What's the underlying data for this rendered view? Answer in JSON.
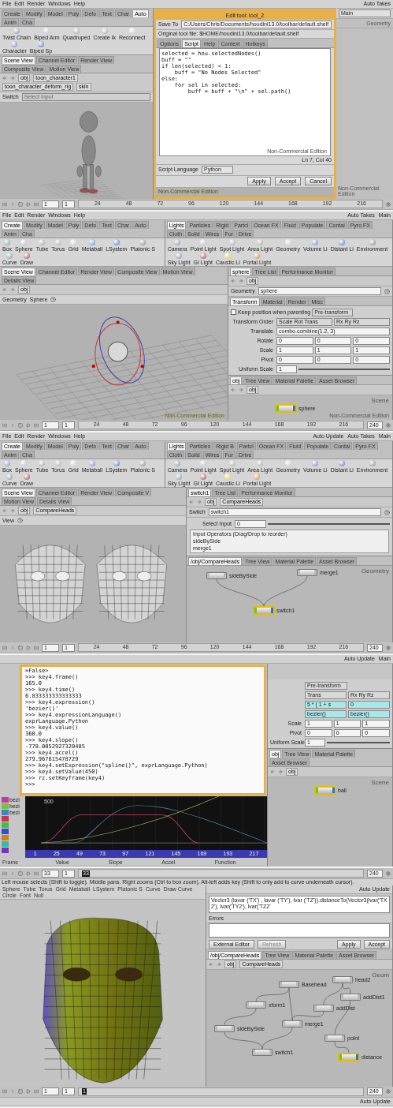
{
  "edit_tool_window": {
    "menu": [
      "File",
      "Edit",
      "Render",
      "Windows",
      "Help"
    ],
    "top_right": [
      "Auto Takes"
    ],
    "shelf": {
      "tabs": [
        {
          "label": "Create",
          "selected": false
        },
        {
          "label": "Modify",
          "selected": false
        },
        {
          "label": "Model",
          "selected": false
        },
        {
          "label": "Poly",
          "selected": false
        },
        {
          "label": "Defo",
          "selected": false
        },
        {
          "label": "Text",
          "selected": false
        },
        {
          "label": "Char",
          "selected": false
        },
        {
          "label": "Auto",
          "selected": true
        },
        {
          "label": "Anim",
          "selected": false
        },
        {
          "label": "Cha",
          "selected": false
        }
      ],
      "tools": [
        "Twist Chain",
        "Biped Arm",
        "Quadruped",
        "Create Ik",
        "Reconnect",
        "Character",
        "Biped Sp"
      ]
    },
    "pane_tabs": [
      {
        "label": "Scene View",
        "selected": true
      },
      {
        "label": "Channel Editor",
        "selected": false
      },
      {
        "label": "Render View",
        "selected": false
      },
      {
        "label": "Composite View",
        "selected": false
      },
      {
        "label": "Motion View",
        "selected": false
      }
    ],
    "path": [
      "obj",
      "toon_character1",
      "toon_character_deform_rig",
      "skin"
    ],
    "operator": {
      "label": "Switch",
      "placeholder": "Select Input"
    },
    "viewport": {
      "kind": "character"
    },
    "dialog": {
      "title": "Edit tool: tool_2",
      "save_to_label": "Save To",
      "save_to": "C:/Users/Chris/Documents/houdini13.0/toolbar/default.shelf",
      "original": "Original tool file: $HOME/houdini13.0/toolbar/default.shelf",
      "tabs": [
        {
          "label": "Options",
          "selected": false
        },
        {
          "label": "Script",
          "selected": true
        },
        {
          "label": "Help",
          "selected": false
        },
        {
          "label": "Context",
          "selected": false
        },
        {
          "label": "Hotkeys",
          "selected": false
        }
      ],
      "code": [
        "selected = hou.selectedNodes()",
        "buff = \"\"",
        "if len(selected) < 1:",
        "    buff = \"No Nodes Selected\"",
        "else:",
        "    for sel in selected:",
        "        buff = buff + \"\\n\" + sel.path()"
      ],
      "note": "Non-Commercial Edition",
      "cursor": "Ln 7, Col 40",
      "language_label": "Script Language",
      "language": "Python",
      "buttons": [
        "Apply",
        "Accept",
        "Cancel"
      ],
      "below_note": "Non-Commercial Edition"
    },
    "side": {
      "title": "Main",
      "context": "Geometry",
      "note": "Non-Commercial Edition"
    },
    "timeline": {
      "frame": "1",
      "step": "1",
      "ticks": [
        "24",
        "48",
        "72",
        "96",
        "120",
        "144",
        "168",
        "192",
        "216"
      ]
    }
  },
  "sphere_window": {
    "menu": [
      "File",
      "Edit",
      "Render",
      "Windows",
      "Help"
    ],
    "top_right": [
      "Auto Takes",
      "Main"
    ],
    "shelves": [
      {
        "tabs": [
          {
            "label": "Create",
            "selected": true
          },
          {
            "label": "Modify",
            "selected": false
          },
          {
            "label": "Model",
            "selected": false
          },
          {
            "label": "Poly",
            "selected": false
          },
          {
            "label": "Defo",
            "selected": false
          },
          {
            "label": "Text",
            "selected": false
          },
          {
            "label": "Char",
            "selected": false
          },
          {
            "label": "Auto",
            "selected": false
          },
          {
            "label": "Anim",
            "selected": false
          },
          {
            "label": "Cha",
            "selected": false
          }
        ],
        "tools": [
          "Box",
          "Sphere",
          "Tube",
          "Torus",
          "Grid",
          "Metaball",
          "LSystem",
          "Platonic S",
          "Curve",
          "Draw"
        ]
      },
      {
        "tabs": [
          {
            "label": "Lights",
            "selected": true
          },
          {
            "label": "Particles",
            "selected": false
          },
          {
            "label": "Rigid",
            "selected": false
          },
          {
            "label": "Partcl",
            "selected": false
          },
          {
            "label": "Ocean FX",
            "selected": false
          },
          {
            "label": "Fluid",
            "selected": false
          },
          {
            "label": "Populate",
            "selected": false
          },
          {
            "label": "Contai",
            "selected": false
          },
          {
            "label": "Pyro FX",
            "selected": false
          },
          {
            "label": "Cloth",
            "selected": false
          },
          {
            "label": "Solid",
            "selected": false
          },
          {
            "label": "Wires",
            "selected": false
          },
          {
            "label": "Fur",
            "selected": false
          },
          {
            "label": "Drive",
            "selected": false
          }
        ],
        "tools": [
          "Camera",
          "Point Light",
          "Spot Light",
          "Area Light",
          "Geometry",
          "Volume Li",
          "Distant Li",
          "Environment",
          "Sky Light",
          "GI Light",
          "Caustic Li",
          "Portal Light"
        ]
      }
    ],
    "pane_tabs": [
      {
        "label": "Scene View",
        "selected": true
      },
      {
        "label": "Channel Editor",
        "selected": false
      },
      {
        "label": "Render View",
        "selected": false
      },
      {
        "label": "Composite View",
        "selected": false
      },
      {
        "label": "Motion View",
        "selected": false
      },
      {
        "label": "Details View",
        "selected": false
      }
    ],
    "path": [
      "obj"
    ],
    "view_tools": [
      "Geometry",
      "Sphere"
    ],
    "viewport": {
      "kind": "sphere",
      "note": "Non-Commercial Edition"
    },
    "params": {
      "kind": "transform",
      "pane_tabs": [
        {
          "label": "sphere",
          "selected": true
        },
        {
          "label": "Tree List",
          "selected": false
        },
        {
          "label": "Performance Monitor",
          "selected": false
        }
      ],
      "path": [
        "obj"
      ],
      "type": "Geometry",
      "name": "sphere",
      "tabs": [
        {
          "label": "Transform",
          "selected": true
        },
        {
          "label": "Material",
          "selected": false
        },
        {
          "label": "Render",
          "selected": false
        },
        {
          "label": "Misc",
          "selected": false
        }
      ],
      "keep": {
        "label": "Keep position when parenting",
        "checked": false
      },
      "pre": "Pre-transform",
      "rows": [
        {
          "kind": "menu",
          "label": "Transform Order",
          "values": [
            "Scale Rot Trans",
            "Rx Ry Rz"
          ]
        },
        {
          "kind": "expression",
          "label": "Translate",
          "values": [
            "combo.combine(1.2, 3)"
          ]
        },
        {
          "kind": "vector",
          "label": "Rotate",
          "values": [
            "0",
            "0",
            "0"
          ]
        },
        {
          "kind": "vector",
          "label": "Scale",
          "values": [
            "1",
            "1",
            "1"
          ]
        },
        {
          "kind": "vector",
          "label": "Pivot",
          "values": [
            "0",
            "0",
            "0"
          ]
        },
        {
          "kind": "slider",
          "label": "Uniform Scale",
          "values": [
            "1"
          ]
        }
      ]
    },
    "network": {
      "tabs": [
        {
          "label": "obj",
          "selected": true
        },
        {
          "label": "Tree View",
          "selected": false
        },
        {
          "label": "Material Palette",
          "selected": false
        },
        {
          "label": "Asset Browser",
          "selected": false
        }
      ],
      "path": [
        "obj"
      ],
      "context": "Scene",
      "nodes": [
        {
          "label": "sphere",
          "selected": true
        }
      ],
      "note": "Non-Commercial Edition"
    },
    "timeline": {
      "frame": "1",
      "step": "1",
      "ticks": [
        "24",
        "48",
        "72",
        "96",
        "120",
        "144",
        "168",
        "192",
        "216"
      ],
      "end": "240"
    }
  },
  "compare_heads_window": {
    "menu": [
      "File",
      "Edit",
      "Render",
      "Windows",
      "Help"
    ],
    "top_right": [
      "Auto Update",
      "Auto Takes",
      "Main"
    ],
    "shelves": [
      {
        "tabs": [
          {
            "label": "Create",
            "selected": true
          },
          {
            "label": "Modify",
            "selected": false
          },
          {
            "label": "Model",
            "selected": false
          },
          {
            "label": "Poly",
            "selected": false
          },
          {
            "label": "Defo",
            "selected": false
          },
          {
            "label": "Text",
            "selected": false
          },
          {
            "label": "Char",
            "selected": false
          },
          {
            "label": "Auto",
            "selected": false
          },
          {
            "label": "Anim",
            "selected": false
          },
          {
            "label": "Cha",
            "selected": false
          }
        ],
        "tools": [
          "Box",
          "Sphere",
          "Tube",
          "Torus",
          "Grid",
          "Metaball",
          "LSystem",
          "Platonic S",
          "Curve",
          "Draw"
        ]
      },
      {
        "tabs": [
          {
            "label": "Lights",
            "selected": true
          },
          {
            "label": "Particles",
            "selected": false
          },
          {
            "label": "Rigid B",
            "selected": false
          },
          {
            "label": "Partcl",
            "selected": false
          },
          {
            "label": "Ocean FX",
            "selected": false
          },
          {
            "label": "Fluid",
            "selected": false
          },
          {
            "label": "Populate",
            "selected": false
          },
          {
            "label": "Contai",
            "selected": false
          },
          {
            "label": "Pyro FX",
            "selected": false
          },
          {
            "label": "Cloth",
            "selected": false
          },
          {
            "label": "Solid",
            "selected": false
          },
          {
            "label": "Wires",
            "selected": false
          },
          {
            "label": "Fur",
            "selected": false
          },
          {
            "label": "Drive",
            "selected": false
          }
        ],
        "tools": [
          "Camera",
          "Point Light",
          "Spot Light",
          "Area Light",
          "Geometry",
          "Volume Li",
          "Distant Li",
          "Environment",
          "Sky Light",
          "GI Light",
          "Caustic Li",
          "Portal Light"
        ]
      }
    ],
    "pane_tabs": [
      {
        "label": "Scene View",
        "selected": true
      },
      {
        "label": "Channel Editor",
        "selected": false
      },
      {
        "label": "Render View",
        "selected": false
      },
      {
        "label": "Composite V",
        "selected": false
      },
      {
        "label": "Motion View",
        "selected": false
      },
      {
        "label": "Details View",
        "selected": false
      }
    ],
    "path": [
      "obj",
      "CompareHeads"
    ],
    "view_tools": [
      "View"
    ],
    "viewport": {
      "kind": "heads"
    },
    "params": {
      "kind": "switch",
      "pane_tabs": [
        {
          "label": "switch1",
          "selected": true
        },
        {
          "label": "Tree List",
          "selected": false
        },
        {
          "label": "Performance Monitor",
          "selected": false
        }
      ],
      "path": [
        "obj",
        "CompareHeads"
      ],
      "type": "Switch",
      "name": "switch1",
      "select_label": "Select Input",
      "select_value": "0",
      "inputs_title": "Input Operators (Drag/Drop to reorder)",
      "inputs": [
        "sideBySide",
        "merge1"
      ]
    },
    "network": {
      "tabs": [
        {
          "label": "/obj/CompareHeads",
          "selected": true
        },
        {
          "label": "Tree View",
          "selected": false
        },
        {
          "label": "Material Palette",
          "selected": false
        },
        {
          "label": "Asset Browser",
          "selected": false
        }
      ],
      "context": "Geometry",
      "nodes": [
        {
          "label": "sideBySide",
          "selected": false
        },
        {
          "label": "merge1",
          "selected": false
        },
        {
          "label": "switch1",
          "selected": true
        }
      ]
    },
    "timeline": {
      "frame": "1",
      "step": "1",
      "ticks": [
        "24",
        "48",
        "72",
        "96",
        "120",
        "144",
        "168",
        "192",
        "216"
      ],
      "end": "240"
    }
  },
  "python_shell_window": {
    "top_right": [
      "Auto Update",
      "Main"
    ],
    "console": [
      "=False>",
      ">>> key4.frame()",
      "165.0",
      ">>> key4.time()",
      "6.833333333333333",
      ">>> key4.expression()",
      "'bezier()'",
      ">>> key4.expressionLanguage()",
      "exprLanguage.Python",
      ">>> key4.value()",
      "360.0",
      ">>> key4.slope()",
      "-778.0052927320485",
      ">>> key4.accel()",
      "279.967815478729",
      ">>> key4.setExpression(\"spline()\", exprLanguage.Python)",
      ">>> key4.setValue(450)",
      ">>> rz.setKeyframe(key4)",
      ">>> "
    ],
    "channels": [
      {
        "color": "#c03aa0",
        "value": "bezi"
      },
      {
        "color": "#7ac03a",
        "value": "bezi"
      },
      {
        "color": "#3a8ac0",
        "value": "bezi"
      },
      {
        "color": "#d03050"
      },
      {
        "color": "#40c040"
      },
      {
        "color": "#3050d0"
      },
      {
        "color": "#d08020"
      },
      {
        "color": "#30c0a0"
      },
      {
        "color": "#8030c0"
      }
    ],
    "graph": {
      "y_label": "500",
      "x_ticks": [
        "1",
        "25",
        "49",
        "73",
        "97",
        "121",
        "145",
        "169",
        "193",
        "217"
      ],
      "columns": [
        "Frame",
        "Value",
        "Slope",
        "Accel",
        "Function"
      ]
    },
    "params": {
      "kind": "animated",
      "pre": "Pre-transform",
      "order": [
        "Trans",
        "Rx Ry Rz"
      ],
      "rows": [
        {
          "kind": "animated",
          "values": [
            "5 * ( 1 + s",
            "0"
          ]
        },
        {
          "kind": "animated",
          "values": [
            "bezier()",
            "bezier()"
          ]
        },
        {
          "kind": "vector",
          "label": "Scale",
          "values": [
            "1",
            "1",
            "1"
          ]
        },
        {
          "kind": "vector",
          "label": "Pivot",
          "values": [
            "0",
            "0",
            "0"
          ]
        },
        {
          "kind": "slider",
          "label": "Uniform Scale",
          "values": [
            "1"
          ]
        }
      ]
    },
    "network": {
      "tabs": [
        {
          "label": "obj",
          "selected": true
        },
        {
          "label": "Tree View",
          "selected": false
        },
        {
          "label": "Material Palette",
          "selected": false
        },
        {
          "label": "Asset Browser",
          "selected": false
        }
      ],
      "path": [
        "obj"
      ],
      "context": "Scene",
      "nodes": [
        {
          "label": "ball",
          "selected": true
        }
      ]
    }
  },
  "expression_window": {
    "timeline_top": {
      "frame": "33",
      "step": "1",
      "current": "33",
      "end": "240"
    },
    "status": "Left mouse selects (Shift to toggle). Middle pans. Right zooms (Ctrl to box zoom). Alt-left adds key (Shift to only add to curve underneath cursor).",
    "tools": [
      "Sphere",
      "Tube",
      "Torus",
      "Grid",
      "Metaball",
      "LSystem",
      "Platonic S",
      "Curve",
      "Draw Curve",
      "Circle",
      "Font",
      "Null"
    ],
    "top_right": [
      "Auto Update"
    ],
    "viewport": {
      "kind": "colored-face"
    },
    "expression": "Vector3 (lavar ('TX') , lavar ('TY'), lvar ('TZ')).distanceTo(Vector3(lvar('TX2'), lvar('TY2'), lvar('TZ2'",
    "errors_label": "Errors",
    "buttons": [
      {
        "label": "External Editor",
        "disabled": false
      },
      {
        "label": "Refresh",
        "disabled": true
      },
      {
        "label": "Apply",
        "disabled": false
      },
      {
        "label": "Accept",
        "disabled": false
      }
    ],
    "network": {
      "tabs": [
        {
          "label": "/obj/CompareHeads",
          "selected": true
        },
        {
          "label": "Tree View",
          "selected": false
        },
        {
          "label": "Material Palette",
          "selected": false
        },
        {
          "label": "Asset Browser",
          "selected": false
        }
      ],
      "path": [
        "obj",
        "CompareHeads"
      ],
      "context": "Geom",
      "nodes": [
        {
          "label": "Basehead",
          "selected": false
        },
        {
          "label": "head2",
          "selected": false
        },
        {
          "label": "xform1",
          "selected": false
        },
        {
          "label": "addDist",
          "selected": false
        },
        {
          "label": "addDist1",
          "selected": false
        },
        {
          "label": "merge1",
          "selected": false
        },
        {
          "label": "sideBySide",
          "selected": false
        },
        {
          "label": "point",
          "selected": false
        },
        {
          "label": "switch1",
          "selected": false
        },
        {
          "label": "distance",
          "selected": true
        }
      ]
    },
    "timeline_bottom": {
      "frame": "1",
      "step": "1",
      "current": "1",
      "end": "240"
    },
    "bottom_right": [
      "Auto Update"
    ]
  }
}
